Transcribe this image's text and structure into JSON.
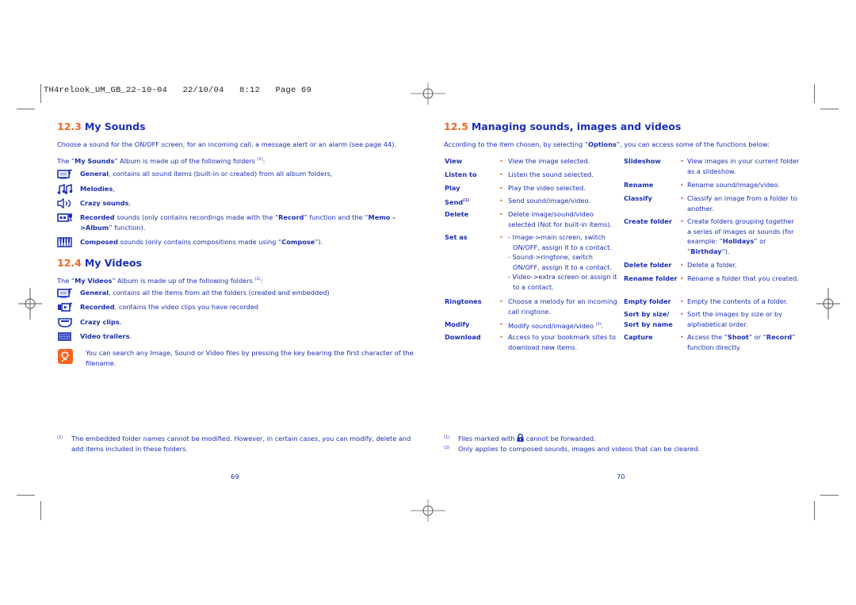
{
  "slug": "TH4relook_UM_GB_22-10-04   22/10/04   8:12   Page 69",
  "left_page": {
    "sec_12_3": {
      "number": "12.3",
      "title": "My Sounds",
      "intro": "Choose a sound for the ON/OFF screen, for an incoming call, a message alert or an alarm (see page 44).",
      "album_pre": "The “",
      "album_name": "My Sounds",
      "album_post": "” Album is made up of the following folders ",
      "album_ref": "(1)",
      "album_end": ":",
      "folders": [
        {
          "icon": "general-sound-folder-icon",
          "name": "General",
          "desc": ", contains all sound items (built-in or created) from all album folders,"
        },
        {
          "icon": "melodies-folder-icon",
          "name": "Melodies",
          "desc": ","
        },
        {
          "icon": "crazy-sounds-folder-icon",
          "name": "Crazy sounds",
          "desc": ","
        },
        {
          "icon": "recorded-sounds-folder-icon",
          "name": "Recorded",
          "desc": " sounds (only contains recordings made with the “",
          "bold2": "Record",
          "desc2": "” function and the “",
          "bold3": "Memo ->Album",
          "desc3": "” function)."
        },
        {
          "icon": "composed-sounds-folder-icon",
          "name": "Composed",
          "desc": " sounds (only contains compositions made using “",
          "bold2": "Compose",
          "desc2": "”)."
        }
      ]
    },
    "sec_12_4": {
      "number": "12.4",
      "title": "My Videos",
      "album_pre": "The “",
      "album_name": "My Videos",
      "album_post": "” Album is made up of the following folders ",
      "album_ref": "(1)",
      "album_end": ":",
      "folders": [
        {
          "icon": "general-video-folder-icon",
          "name": "General",
          "desc": ", contains all the items from all the folders (created and embedded)"
        },
        {
          "icon": "recorded-video-folder-icon",
          "name": "Recorded",
          "desc": ", contains the video clips you have recorded"
        },
        {
          "icon": "crazy-clips-folder-icon",
          "name": "Crazy clips",
          "desc": ","
        },
        {
          "icon": "video-trailers-folder-icon",
          "name": "Video trailers",
          "desc": "."
        }
      ],
      "tip": "You can search any Image, Sound or Video files by pressing the key bearing the first character of the filename."
    },
    "footnote": {
      "ref": "(1)",
      "text": "The embedded folder names cannot be modified. However, in certain cases, you can modify, delete and add items included in these folders."
    },
    "page_number": "69"
  },
  "right_page": {
    "sec_12_5": {
      "number": "12.5",
      "title": "Managing sounds, images and videos",
      "intro_pre": "According to the item chosen, by selecting “",
      "intro_bold": "Options",
      "intro_post": "”, you can access some of the functions below:",
      "col1": [
        {
          "term": "View",
          "def": "View the image selected."
        },
        {
          "term": "Listen to",
          "def": "Listen the sound selected."
        },
        {
          "term": "Play",
          "def": "Play the video selected."
        },
        {
          "term": "Send",
          "term_ref": "(1)",
          "def": "Send sound/image/video."
        },
        {
          "term": "Delete",
          "def": "Delete image/sound/video selected (Not for built-in items)."
        },
        {
          "term": "Set as",
          "def_lines": [
            "- Image->main screen, switch ON/OFF, assign it to a contact.",
            "- Sound->ringtone, switch ON/OFF, assign it to a contact.",
            "- Video->extra screen or assign it to a contact."
          ]
        },
        {
          "term": "Ringtones",
          "def": "Choose a melody for an incoming call ringtone."
        },
        {
          "term": "Modify",
          "def": "Modify sound/image/video ",
          "def_ref": "(2)",
          "def_end": "."
        },
        {
          "term": "Download",
          "def": "Access to your bookmark sites to download new items."
        }
      ],
      "col2": [
        {
          "term": "Slideshow",
          "def": "View images in your current folder as a slideshow."
        },
        {
          "term": "Rename",
          "def": "Rename sound/image/video."
        },
        {
          "term": "Classify",
          "def": "Classify an image from a folder to another."
        },
        {
          "term": "Create folder",
          "def": "Create folders grouping together a series of images or sounds (for example: “",
          "bold1": "Holidays",
          "mid": "” or “",
          "bold2": "Birthday",
          "end": "”)."
        },
        {
          "term": "Delete folder",
          "def": "Delete a folder."
        },
        {
          "term": "Rename folder",
          "def": "Rename a folder that you created."
        },
        {
          "term": "Empty folder",
          "def": "Empty the contents of a folder."
        },
        {
          "term": "Sort by size/",
          "term2": "Sort by name",
          "def": "Sort the images by size or by alphabetical order."
        },
        {
          "term": "Capture",
          "def": "Access the “",
          "bold1": "Shoot",
          "mid": "” or “",
          "bold2": "Record",
          "end": "” function directly."
        }
      ]
    },
    "footnotes": [
      {
        "ref": "(1)",
        "pre": "Files marked with ",
        "icon": "lock-icon",
        "post": " cannot be forwarded."
      },
      {
        "ref": "(2)",
        "text": "Only applies to composed sounds, images and videos that can be cleared."
      }
    ],
    "page_number": "70"
  },
  "bullet": "•",
  "colors": {
    "text": "#1a2fb5",
    "accent": "#f26522",
    "crop_marks": "#6f6f6f"
  }
}
